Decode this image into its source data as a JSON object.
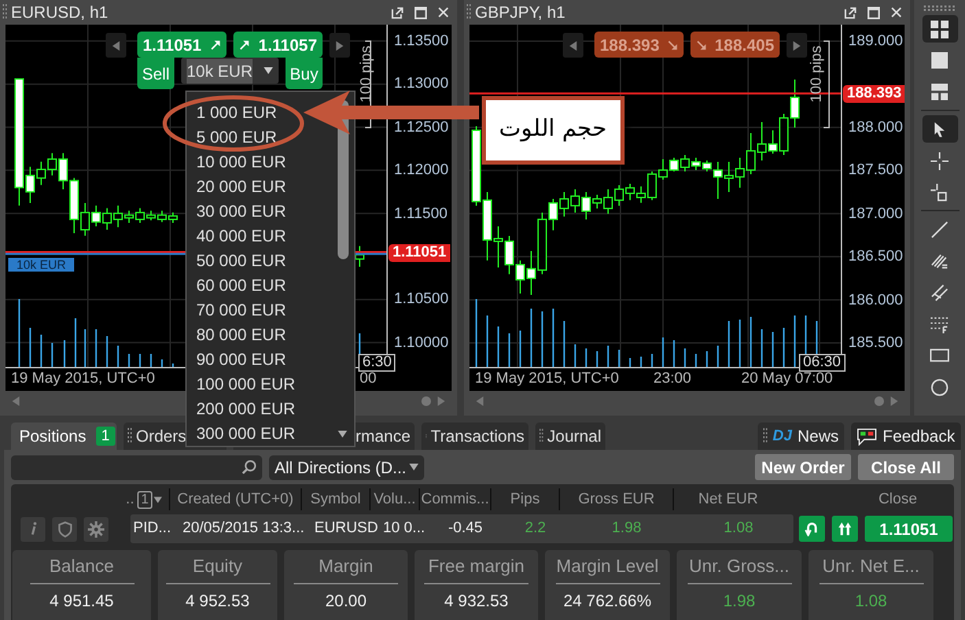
{
  "charts": [
    {
      "title": "EURUSD, h1",
      "rising": true,
      "sell_price": "1.11051",
      "buy_price": "1.11057",
      "sell_label": "Sell",
      "buy_label": "Buy",
      "amount": "10k EUR",
      "range_label": "100 pips",
      "time_labels": [
        "19 May 2015, UTC+0",
        "00"
      ],
      "time_tag": "6:30",
      "amount_options": [
        "1 000 EUR",
        "5 000 EUR",
        "10 000 EUR",
        "20 000 EUR",
        "30 000 EUR",
        "40 000 EUR",
        "50 000 EUR",
        "60 000 EUR",
        "70 000 EUR",
        "80 000 EUR",
        "90 000 EUR",
        "100 000 EUR",
        "200 000 EUR",
        "300 000 EUR"
      ],
      "chart_data": {
        "type": "candlestick",
        "grid": true,
        "ylim": [
          1.0971,
          1.1369
        ],
        "ohlc": [
          [
            1.1306,
            1.1306,
            1.1159,
            1.118
          ],
          [
            1.1194,
            1.1204,
            1.1162,
            1.1175
          ],
          [
            1.1191,
            1.121,
            1.1183,
            1.1201
          ],
          [
            1.1201,
            1.122,
            1.1194,
            1.1213
          ],
          [
            1.1213,
            1.122,
            1.1178,
            1.1188
          ],
          [
            1.1188,
            1.1191,
            1.1127,
            1.1143
          ],
          [
            1.1131,
            1.1162,
            1.1124,
            1.1151
          ],
          [
            1.1151,
            1.1159,
            1.1135,
            1.114
          ],
          [
            1.1139,
            1.1156,
            1.1131,
            1.115
          ],
          [
            1.1143,
            1.1159,
            1.1134,
            1.115
          ],
          [
            1.1145,
            1.1153,
            1.1139,
            1.1148
          ],
          [
            1.1143,
            1.1156,
            1.1139,
            1.1151
          ],
          [
            1.1145,
            1.1153,
            1.1142,
            1.1148
          ],
          [
            1.1143,
            1.1153,
            1.114,
            1.1148
          ],
          [
            1.1143,
            1.1151,
            1.1139,
            1.1147
          ],
          null,
          null,
          null,
          null,
          null,
          null,
          null,
          null,
          null,
          null,
          null,
          null,
          null,
          null,
          null,
          null,
          [
            1.1097,
            1.1112,
            1.1088,
            1.1102
          ]
        ],
        "yticks": [
          {
            "value": 1.135,
            "label": "1.13500"
          },
          {
            "value": 1.13,
            "label": "1.13000"
          },
          {
            "value": 1.125,
            "label": "1.12500"
          },
          {
            "value": 1.12,
            "label": "1.12000"
          },
          {
            "value": 1.115,
            "label": "1.11500"
          },
          {
            "value": 1.105,
            "label": "1.10500"
          },
          {
            "value": 1.1,
            "label": "1.10000"
          }
        ],
        "ref_lines": [
          {
            "axis": "y",
            "value": 1.11051,
            "label": "1.11051",
            "color": "#e02020"
          },
          {
            "axis": "y",
            "value": 1.11029,
            "label": "10k EUR",
            "color": "#2a7ac8"
          }
        ]
      }
    },
    {
      "title": "GBPJPY, h1",
      "rising": false,
      "sell_price": "188.393",
      "buy_price": "188.405",
      "range_label": "100 pips",
      "time_labels": [
        "19 May 2015, UTC+0",
        "23:00",
        "20 May 07:00"
      ],
      "time_tag": "06:30",
      "chart_data": {
        "type": "candlestick",
        "grid": true,
        "ylim": [
          185.214,
          189.191
        ],
        "ohlc": [
          [
            187.966,
            188.014,
            187.092,
            187.14
          ],
          [
            187.156,
            187.251,
            186.456,
            186.694
          ],
          [
            186.694,
            186.853,
            186.376,
            186.71
          ],
          [
            186.679,
            186.742,
            186.297,
            186.408
          ],
          [
            186.408,
            186.456,
            186.074,
            186.233
          ],
          [
            186.361,
            186.567,
            186.058,
            186.249
          ],
          [
            186.345,
            187.012,
            186.297,
            186.933
          ],
          [
            187.124,
            187.171,
            186.806,
            186.933
          ],
          [
            187.06,
            187.251,
            186.965,
            187.171
          ],
          [
            187.092,
            187.283,
            187.012,
            187.203
          ],
          [
            187.187,
            187.251,
            186.933,
            187.028
          ],
          [
            187.124,
            187.219,
            187.06,
            187.171
          ],
          [
            187.06,
            187.283,
            186.997,
            187.187
          ],
          [
            187.156,
            187.33,
            187.092,
            187.283
          ],
          [
            187.235,
            187.346,
            187.156,
            187.299
          ],
          [
            187.187,
            187.315,
            187.124,
            187.235
          ],
          [
            187.187,
            187.489,
            187.156,
            187.458
          ],
          [
            187.426,
            187.633,
            187.394,
            187.505
          ],
          [
            187.617,
            187.648,
            187.489,
            187.505
          ],
          [
            187.537,
            187.68,
            187.489,
            187.633
          ],
          [
            187.601,
            187.648,
            187.505,
            187.553
          ],
          [
            187.585,
            187.617,
            187.489,
            187.521
          ],
          [
            187.505,
            187.601,
            187.171,
            187.426
          ],
          [
            187.426,
            187.601,
            187.251,
            187.442
          ],
          [
            187.426,
            187.648,
            187.299,
            187.521
          ],
          [
            187.505,
            187.935,
            187.458,
            187.728
          ],
          [
            187.712,
            188.062,
            187.617,
            187.807
          ],
          [
            187.807,
            187.966,
            187.696,
            187.728
          ],
          [
            187.728,
            188.157,
            187.68,
            188.11
          ],
          [
            188.348,
            188.555,
            187.998,
            188.11
          ]
        ],
        "yticks": [
          {
            "value": 189,
            "label": "189.000"
          },
          {
            "value": 188,
            "label": "188.000"
          },
          {
            "value": 187.5,
            "label": "187.500"
          },
          {
            "value": 187,
            "label": "187.000"
          },
          {
            "value": 186.5,
            "label": "186.500"
          },
          {
            "value": 186,
            "label": "186.000"
          },
          {
            "value": 185.5,
            "label": "185.500"
          }
        ],
        "ref_lines": [
          {
            "axis": "y",
            "value": 188.393,
            "label": "188.393",
            "color": "#e02020"
          }
        ]
      }
    }
  ],
  "annotation": {
    "text": "حجم اللوت"
  },
  "toolbar": [
    {
      "kind": "layout-grid",
      "selected": true
    },
    {
      "kind": "layout-single",
      "selected": false
    },
    {
      "kind": "layout-rows",
      "selected": false
    },
    {
      "kind": "pointer",
      "selected": true
    },
    {
      "kind": "crosshair",
      "selected": false
    },
    {
      "kind": "crosshair-box",
      "selected": false
    },
    {
      "kind": "line",
      "selected": false
    },
    {
      "kind": "fibonacci",
      "selected": false
    },
    {
      "kind": "channel",
      "selected": false
    },
    {
      "kind": "grid-f",
      "selected": false
    },
    {
      "kind": "rectangle",
      "selected": false
    },
    {
      "kind": "circle",
      "selected": false
    }
  ],
  "tabs": [
    {
      "label": "Positions",
      "badge": "1",
      "selected": true
    },
    {
      "label": "Orders",
      "selected": false
    },
    {
      "label": "rmance",
      "selected": false
    },
    {
      "label": "Transactions",
      "selected": false
    },
    {
      "label": "Journal",
      "selected": false
    }
  ],
  "links": [
    {
      "kind": "news",
      "logo": "DJ",
      "label": "News"
    },
    {
      "kind": "feedback",
      "label": "Feedback"
    }
  ],
  "filter": {
    "direction": "All Directions (D..."
  },
  "actions": [
    "New Order",
    "Close All"
  ],
  "table": {
    "column_counter": "1",
    "columns": [
      "..",
      "Created (UTC+0)",
      "Symbol",
      "Volu...",
      "Commis...",
      "Pips",
      "Gross EUR",
      "Net EUR",
      "Close"
    ],
    "rows": [
      {
        "cells": [
          {
            "text": "PID...",
            "positive": false
          },
          {
            "text": "20/05/2015 13:3...",
            "positive": false
          },
          {
            "text": "EURUSD",
            "positive": false
          },
          {
            "text": "10 0...",
            "positive": false
          },
          {
            "text": "-0.45",
            "positive": false
          },
          {
            "text": "2.2",
            "positive": true
          },
          {
            "text": "1.98",
            "positive": true
          },
          {
            "text": "1.08",
            "positive": true
          }
        ],
        "close_price": "1.11051"
      }
    ]
  },
  "summary": [
    {
      "label": "Balance",
      "value": "4 951.45",
      "positive": false
    },
    {
      "label": "Equity",
      "value": "4 952.53",
      "positive": false
    },
    {
      "label": "Margin",
      "value": "20.00",
      "positive": false
    },
    {
      "label": "Free margin",
      "value": "4 932.53",
      "positive": false
    },
    {
      "label": "Margin Level",
      "value": "24 762.66%",
      "positive": false
    },
    {
      "label": "Unr. Gross...",
      "value": "1.98",
      "positive": true
    },
    {
      "label": "Unr. Net E...",
      "value": "1.08",
      "positive": true
    }
  ]
}
